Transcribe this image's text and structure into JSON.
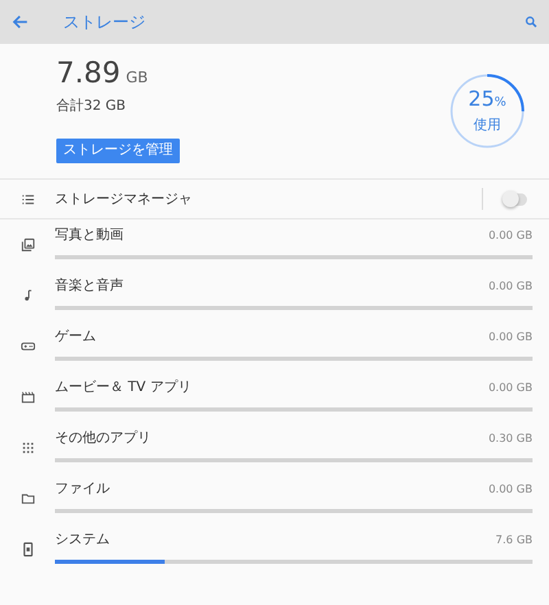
{
  "app_bar": {
    "title": "ストレージ"
  },
  "summary": {
    "used": "7.89",
    "unit": "GB",
    "total": "合計32 GB",
    "button": "ストレージを管理",
    "percent": "25",
    "percent_sign": "%",
    "percent_label": "使用",
    "level": 0.25
  },
  "storage_manager": {
    "label": "ストレージマネージャ",
    "on": false
  },
  "categories": [
    {
      "kind": "photos",
      "label": "写真と動画",
      "size": "0.00 GB",
      "level": 0
    },
    {
      "kind": "music",
      "label": "音楽と音声",
      "size": "0.00 GB",
      "level": 0
    },
    {
      "kind": "games",
      "label": "ゲーム",
      "size": "0.00 GB",
      "level": 0
    },
    {
      "kind": "movies",
      "label": "ムービー＆ TV アプリ",
      "size": "0.00 GB",
      "level": 0
    },
    {
      "kind": "apps",
      "label": "その他のアプリ",
      "size": "0.30 GB",
      "level": 0
    },
    {
      "kind": "files",
      "label": "ファイル",
      "size": "0.00 GB",
      "level": 0
    },
    {
      "kind": "system",
      "label": "システム",
      "size": "7.6 GB",
      "level": 0.23
    }
  ]
}
